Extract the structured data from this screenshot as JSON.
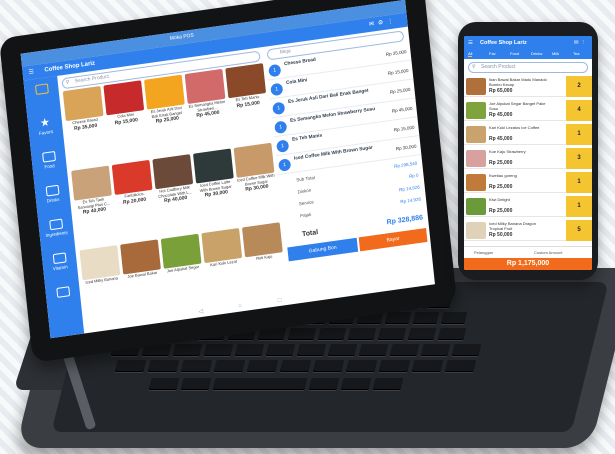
{
  "tablet": {
    "window_title": "Coffee Shop Lariz",
    "app_logo_text": "Moka POS",
    "search_product_placeholder": "Search Product",
    "table_placeholder": "Meja",
    "sidebar": [
      {
        "label": "",
        "icon": "grid-icon"
      },
      {
        "label": "Favorit",
        "icon": "star-icon"
      },
      {
        "label": "Food",
        "icon": "folder-icon"
      },
      {
        "label": "Drinks",
        "icon": "folder-icon"
      },
      {
        "label": "Ingredients",
        "icon": "folder-icon"
      },
      {
        "label": "Vitamin",
        "icon": "folder-icon"
      },
      {
        "label": "",
        "icon": "gift-icon"
      }
    ],
    "products": [
      {
        "name": "Cheese Bread",
        "price": "Rp 35,000",
        "color": "#d9a457"
      },
      {
        "name": "Cola Mini",
        "price": "Rp 15,000",
        "color": "#c72a2a"
      },
      {
        "name": "Es Jeruk Asli Dari Bali Enak Banget",
        "price": "Rp 25,000",
        "color": "#f3a51f"
      },
      {
        "name": "Es Semangka Melon Strawberi...",
        "price": "Rp 45,000",
        "color": "#d36a6a"
      },
      {
        "name": "Es Teh Manis",
        "price": "Rp 15,000",
        "color": "#8a4a2a"
      },
      {
        "name": "Es Teh Tarik Sarwangi Plus C...",
        "price": "Rp 40,000",
        "color": "#caa27a"
      },
      {
        "name": "Fantalicius",
        "price": "Rp 20,000",
        "color": "#d93a2a"
      },
      {
        "name": "Hot Cadbury Milk Chocolate With L...",
        "price": "Rp 40,000",
        "color": "#6b4a3a"
      },
      {
        "name": "Iced Coffee Latte With Brown Sugar",
        "price": "Rp 30,000",
        "color": "#2e3a3a"
      },
      {
        "name": "Iced Coffee Milk With Brown Sugar",
        "price": "Rp 30,000",
        "color": "#c89a6a"
      },
      {
        "name": "Iced Milky Banana",
        "price": "",
        "color": "#e8dcc4"
      },
      {
        "name": "Joe Bawal Bakar",
        "price": "",
        "color": "#a86a3a"
      },
      {
        "name": "Joe Alpukat Segar",
        "price": "",
        "color": "#7aa03a"
      },
      {
        "name": "Kari Kuki Lezat",
        "price": "",
        "color": "#c9a26a"
      },
      {
        "name": "Roti Kaju",
        "price": "",
        "color": "#b88a5a"
      }
    ],
    "cart": [
      {
        "qty": "1",
        "name": "Cheese Bread",
        "price": "Rp 35,000"
      },
      {
        "qty": "1",
        "name": "Cola Mini",
        "price": "Rp 15,000"
      },
      {
        "qty": "1",
        "name": "Es Jeruk Asli Dari Bali Enak Banget",
        "price": "Rp 25,000"
      },
      {
        "qty": "1",
        "name": "Es Semangka Melon Strawberry Susu",
        "price": "Rp 45,000"
      },
      {
        "qty": "1",
        "name": "Es Teh Manis",
        "price": "Rp 15,000"
      },
      {
        "qty": "1",
        "name": "Iced Coffee Milk With Brown Sugar",
        "price": "Rp 30,000"
      }
    ],
    "summary": [
      {
        "label": "Sub Total",
        "value": "Rp 298,540"
      },
      {
        "label": "Diskon",
        "value": "Rp 0"
      },
      {
        "label": "Service",
        "value": "Rp 14,926"
      },
      {
        "label": "Pajak",
        "value": "Rp 14,926"
      }
    ],
    "total_label": "Total",
    "total_value": "Rp 328,886",
    "merge_button": "Gabung Bon",
    "pay_button": "Bayar"
  },
  "phone": {
    "title": "Coffee Shop Lariz",
    "search_placeholder": "Search Product",
    "tabs": [
      "All",
      "Fav",
      "Food",
      "Drinks",
      "Milk",
      "Tea"
    ],
    "items": [
      {
        "name": "Ikan Bawal Bakar Madu Manado Bumbu Kecap",
        "price": "Rp 65,000",
        "qty": "2",
        "color": "#b0703a"
      },
      {
        "name": "Joe Alpukat Segar Banget Pake Susu",
        "price": "Rp 45,000",
        "qty": "4",
        "color": "#7fa43d"
      },
      {
        "name": "Kari Kuki Lezatos Ice Coffee",
        "price": "Rp 45,000",
        "qty": "1",
        "color": "#c9a36b"
      },
      {
        "name": "Kue Kaju Strawberry",
        "price": "Rp 25,000",
        "qty": "3",
        "color": "#d9a0a0"
      },
      {
        "name": "Kwetiau goreng",
        "price": "Rp 25,000",
        "qty": "1",
        "color": "#c27a3a"
      },
      {
        "name": "Kiwi Delight",
        "price": "Rp 25,000",
        "qty": "1",
        "color": "#6a9a3a"
      },
      {
        "name": "Iced Milky Banana Dragon Tropical Fruit",
        "price": "Rp 50,000",
        "qty": "5",
        "color": "#e0d2b8"
      }
    ],
    "customer_label": "Pelanggan",
    "custom_amount_label": "Custom Amount",
    "total": "Rp 1,175,000"
  },
  "colors": {
    "primary": "#2f80ed",
    "accent": "#f5c431",
    "pay": "#f26b1d"
  }
}
